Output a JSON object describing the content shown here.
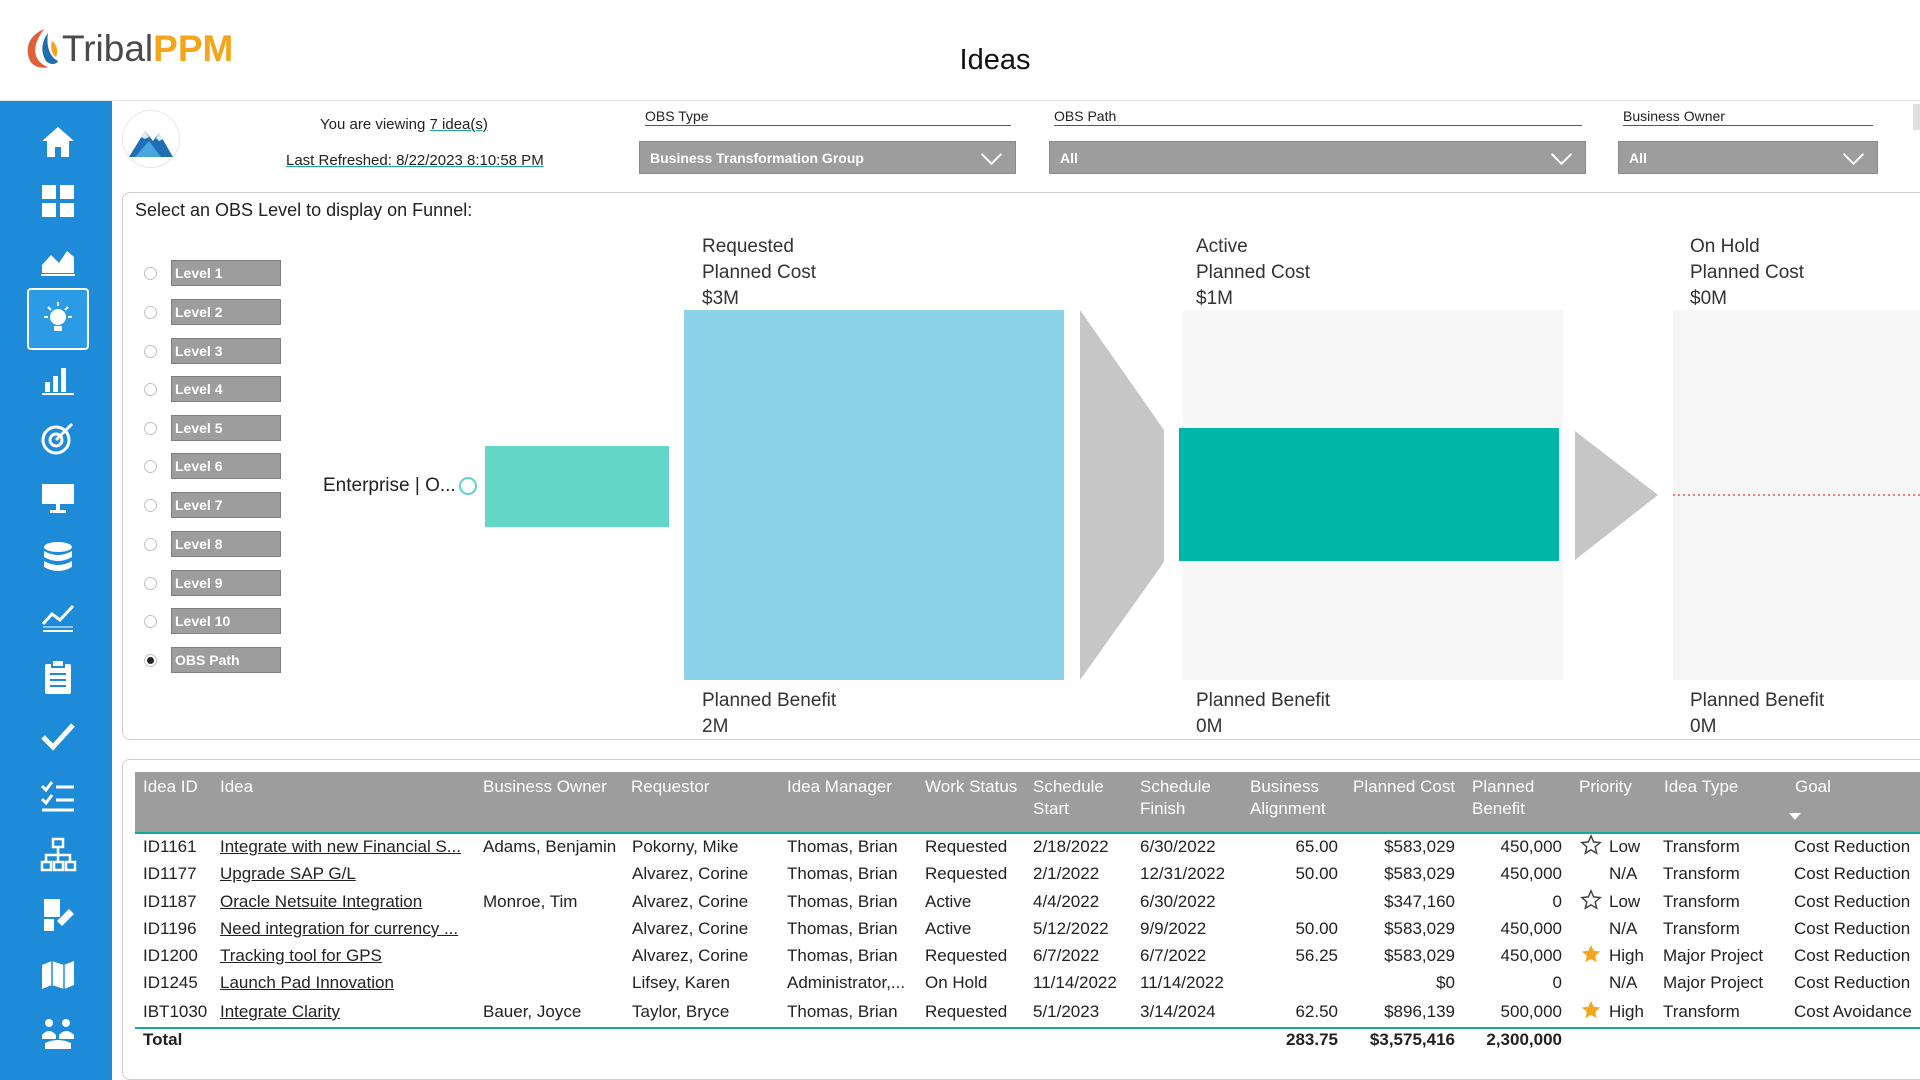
{
  "brand": {
    "part1": "Tribal",
    "part2": "PPM"
  },
  "page": {
    "title": "Ideas"
  },
  "sidebar": {
    "items": [
      {
        "icon": "home-icon"
      },
      {
        "icon": "dashboard-icon"
      },
      {
        "icon": "area-chart-icon"
      },
      {
        "icon": "lightbulb-icon",
        "active": true
      },
      {
        "icon": "bar-chart-icon"
      },
      {
        "icon": "target-icon"
      },
      {
        "icon": "presentation-icon"
      },
      {
        "icon": "database-icon"
      },
      {
        "icon": "trend-chart-icon"
      },
      {
        "icon": "clipboard-icon"
      },
      {
        "icon": "checkmark-icon"
      },
      {
        "icon": "checklist-icon"
      },
      {
        "icon": "org-chart-icon"
      },
      {
        "icon": "roadmap-icon"
      },
      {
        "icon": "map-icon"
      },
      {
        "icon": "people-icon"
      }
    ]
  },
  "header": {
    "viewing_prefix": "You are viewing ",
    "viewing_count": "7",
    "viewing_suffix": " idea(s)",
    "refreshed_label": "Last Refreshed:",
    "refreshed_value": " 8/22/2023 8:10:58 PM"
  },
  "filters": {
    "obs_type": {
      "label": "OBS Type",
      "value": "Business Transformation Group"
    },
    "obs_path": {
      "label": "OBS Path",
      "value": "All"
    },
    "business_owner": {
      "label": "Business Owner",
      "value": "All"
    }
  },
  "funnel": {
    "prompt": "Select an OBS Level to display on Funnel:",
    "levels": [
      "Level 1",
      "Level 2",
      "Level 3",
      "Level 4",
      "Level 5",
      "Level 6",
      "Level 7",
      "Level 8",
      "Level 9",
      "Level 10",
      "OBS Path"
    ],
    "selected_level": "OBS Path",
    "enterprise_label": "Enterprise | O...",
    "stages": [
      {
        "name": "Requested",
        "cost_label": "Planned Cost",
        "cost": "$3M",
        "benefit_label": "Planned Benefit",
        "benefit": "2M"
      },
      {
        "name": "Active",
        "cost_label": "Planned Cost",
        "cost": "$1M",
        "benefit_label": "Planned Benefit",
        "benefit": "0M"
      },
      {
        "name": "On Hold",
        "cost_label": "Planned Cost",
        "cost": "$0M",
        "benefit_label": "Planned Benefit",
        "benefit": "0M"
      }
    ]
  },
  "table": {
    "headers": [
      "Idea ID",
      "Idea",
      "Business Owner",
      "Requestor",
      "Idea Manager",
      "Work Status",
      "Schedule\nStart",
      "Schedule\nFinish",
      "Business\nAlignment",
      "Planned Cost",
      "Planned\nBenefit",
      "Priority",
      "Idea Type",
      "Goal"
    ],
    "rows": [
      {
        "id": "ID1161",
        "idea": "Integrate with new Financial S...",
        "owner": "Adams, Benjamin",
        "requestor": "Pokorny, Mike",
        "manager": "Thomas, Brian",
        "status": "Requested",
        "start": "2/18/2022",
        "finish": "6/30/2022",
        "alignment": "65.00",
        "cost": "$583,029",
        "benefit": "450,000",
        "priority_icon": "star-outline-icon",
        "priority": "Low",
        "type": "Transform",
        "goal": "Cost Reduction"
      },
      {
        "id": "ID1177",
        "idea": "Upgrade SAP G/L",
        "owner": "",
        "requestor": "Alvarez, Corine",
        "manager": "Thomas, Brian",
        "status": "Requested",
        "start": "2/1/2022",
        "finish": "12/31/2022",
        "alignment": "50.00",
        "cost": "$583,029",
        "benefit": "450,000",
        "priority_icon": "",
        "priority": "N/A",
        "type": "Transform",
        "goal": "Cost Reduction"
      },
      {
        "id": "ID1187",
        "idea": "Oracle Netsuite Integration",
        "owner": "Monroe, Tim",
        "requestor": "Alvarez, Corine",
        "manager": "Thomas, Brian",
        "status": "Active",
        "start": "4/4/2022",
        "finish": "6/30/2022",
        "alignment": "",
        "cost": "$347,160",
        "benefit": "0",
        "priority_icon": "star-outline-icon",
        "priority": "Low",
        "type": "Transform",
        "goal": "Cost Reduction"
      },
      {
        "id": "ID1196",
        "idea": "Need integration for currency ...",
        "owner": "",
        "requestor": "Alvarez, Corine",
        "manager": "Thomas, Brian",
        "status": "Active",
        "start": "5/12/2022",
        "finish": "9/9/2022",
        "alignment": "50.00",
        "cost": "$583,029",
        "benefit": "450,000",
        "priority_icon": "",
        "priority": "N/A",
        "type": "Transform",
        "goal": "Cost Reduction"
      },
      {
        "id": "ID1200",
        "idea": "Tracking tool for GPS",
        "owner": "",
        "requestor": "Alvarez, Corine",
        "manager": "Thomas, Brian",
        "status": "Requested",
        "start": "6/7/2022",
        "finish": "6/7/2022",
        "alignment": "56.25",
        "cost": "$583,029",
        "benefit": "450,000",
        "priority_icon": "star-filled-icon",
        "priority": "High",
        "type": "Major Project",
        "goal": "Cost Reduction"
      },
      {
        "id": "ID1245",
        "idea": "Launch Pad Innovation",
        "owner": "",
        "requestor": "Lifsey, Karen",
        "manager": "Administrator,...",
        "status": "On Hold",
        "start": "11/14/2022",
        "finish": "11/14/2022",
        "alignment": "",
        "cost": "$0",
        "benefit": "0",
        "priority_icon": "",
        "priority": "N/A",
        "type": "Major Project",
        "goal": "Cost Reduction"
      },
      {
        "id": "IBT1030",
        "idea": "Integrate Clarity",
        "owner": "Bauer, Joyce",
        "requestor": "Taylor, Bryce",
        "manager": "Thomas, Brian",
        "status": "Requested",
        "start": "5/1/2023",
        "finish": "3/14/2024",
        "alignment": "62.50",
        "cost": "$896,139",
        "benefit": "500,000",
        "priority_icon": "star-filled-icon",
        "priority": "High",
        "type": "Transform",
        "goal": "Cost Avoidance"
      }
    ],
    "totals": {
      "label": "Total",
      "alignment": "283.75",
      "cost": "$3,575,416",
      "benefit": "2,300,000"
    }
  },
  "colors": {
    "sidebar": "#1e8bd9",
    "requested": "#8cd3ea",
    "active": "#00b6a7",
    "enterprise": "#63d6c8",
    "funnel_arrow": "#c6c6c6",
    "slicer": "#9d9d9d",
    "accent": "#16a89a",
    "star": "#f4a51c"
  }
}
